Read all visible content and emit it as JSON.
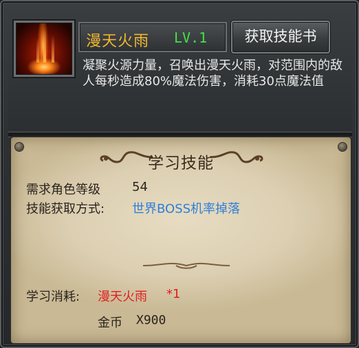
{
  "skill": {
    "name": "漫天火雨",
    "level": "LV.1",
    "icon": "fire-rain-icon",
    "description": "凝聚火源力量，召唤出漫天火雨，对范围内的敌人每秒造成80%魔法伤害，消耗30点魔法值"
  },
  "get_book_button": "获取技能书",
  "learn_panel": {
    "title": "学习技能",
    "required_level_label": "需求角色等级",
    "required_level_value": "54",
    "acquire_label": "技能获取方式:",
    "acquire_value": "世界BOSS机率掉落",
    "cost_label": "学习消耗:",
    "cost_item": "漫天火雨",
    "cost_item_qty": "*1",
    "gold_label": "金币",
    "gold_value": "X900"
  },
  "colors": {
    "skill_name": "#f0b72f",
    "level": "#3ee24a",
    "acquire_value": "#2e7fd8",
    "cost_item": "#e02020"
  }
}
